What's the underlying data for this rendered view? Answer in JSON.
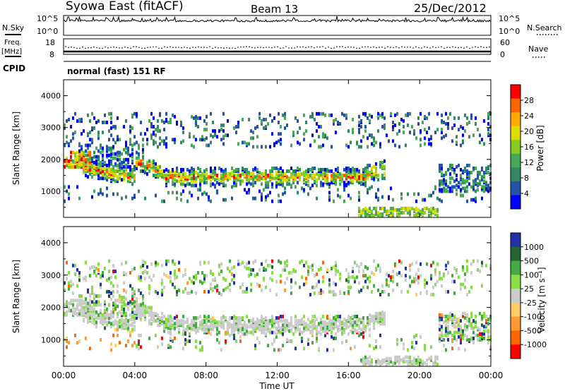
{
  "header": {
    "station": "Syowa East (fitACF)",
    "beam": "Beam 13",
    "date": "25/Dec/2012"
  },
  "noise_panel": {
    "left_label": "N.Sky",
    "left_ticks": [
      "10^5",
      "10^0"
    ],
    "right_label": "N.Search",
    "right_ticks": [
      "10^5",
      "10^0"
    ]
  },
  "freq_panel": {
    "left_label_line1": "Freq.",
    "left_label_line2": "[MHz]",
    "left_ticks": [
      "18",
      "8"
    ],
    "right_label": "Nave",
    "right_ticks": [
      "60",
      "0"
    ]
  },
  "cpid": {
    "label": "CPID",
    "mode": "normal (fast) 151 RF"
  },
  "power_panel": {
    "ylabel": "Slant Range [km]",
    "yticks": [
      "4000",
      "3000",
      "2000",
      "1000"
    ],
    "colorbar_label": "Power [dB]",
    "colorbar_ticks": [
      "28",
      "24",
      "20",
      "16",
      "12",
      "8",
      "4"
    ],
    "colors": [
      "#ff0000",
      "#ff6600",
      "#ffaa00",
      "#dddd00",
      "#88cc22",
      "#44aa55",
      "#338866",
      "#2255aa",
      "#0000ff"
    ]
  },
  "velocity_panel": {
    "ylabel": "Slant Range [km]",
    "yticks": [
      "4000",
      "3000",
      "2000",
      "1000"
    ],
    "colorbar_label": "Velocity [m s⁻¹]",
    "colorbar_ticks": [
      "1000",
      "500",
      "100",
      "25",
      "-25",
      "-100",
      "-500",
      "-1000"
    ],
    "colors": [
      "#2233aa",
      "#226633",
      "#44aa44",
      "#88dd44",
      "#cccccc",
      "#ffcc66",
      "#ff9933",
      "#ff6600",
      "#ff0000"
    ]
  },
  "xaxis": {
    "label": "Time UT",
    "ticks": [
      "00:00",
      "04:00",
      "08:00",
      "12:00",
      "16:00",
      "20:00",
      "00:00"
    ]
  },
  "chart_data": {
    "type": "heatmap",
    "x_range": [
      "00:00",
      "24:00"
    ],
    "y_range_km": [
      180,
      4500
    ],
    "noise_sky_range": [
      "10^0",
      "10^5"
    ],
    "freq_range_mhz": [
      8,
      18
    ],
    "nave_range": [
      0,
      60
    ],
    "power_scale_db": [
      0,
      30
    ],
    "velocity_scale_ms": [
      -1000,
      1000
    ],
    "features": [
      {
        "name": "main echo band",
        "time": [
          "04:00",
          "17:00"
        ],
        "range_km": [
          1200,
          1800
        ]
      },
      {
        "name": "near range band",
        "time": [
          "16:30",
          "21:00"
        ],
        "range_km": [
          300,
          400
        ]
      },
      {
        "name": "upper scatter",
        "time": [
          "00:00",
          "24:00"
        ],
        "range_km": [
          2500,
          3300
        ]
      }
    ]
  }
}
